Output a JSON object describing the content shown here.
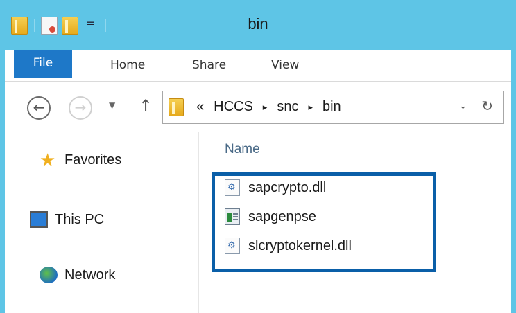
{
  "window": {
    "title": "bin"
  },
  "quick_access": {
    "icons": [
      "folder-icon",
      "properties-icon",
      "new-folder-icon",
      "customize-dropdown-icon"
    ],
    "dropdown_glyph": "="
  },
  "ribbon": {
    "tabs": [
      {
        "label": "File",
        "active": true
      },
      {
        "label": "Home"
      },
      {
        "label": "Share"
      },
      {
        "label": "View"
      }
    ]
  },
  "navigation": {
    "back_glyph": "←",
    "forward_glyph": "→",
    "recent_glyph": "▼",
    "up_glyph": "↑"
  },
  "address": {
    "overflow": "«",
    "crumbs": [
      "HCCS",
      "snc",
      "bin"
    ],
    "separator": "▸",
    "dropdown_glyph": "⌄",
    "refresh_glyph": "↻"
  },
  "nav_pane": {
    "items": [
      {
        "label": "Favorites",
        "icon": "star-icon"
      },
      {
        "label": "This PC",
        "icon": "computer-icon"
      },
      {
        "label": "Network",
        "icon": "network-icon"
      }
    ]
  },
  "file_list": {
    "column_header": "Name",
    "highlight_color": "#0a5fa8",
    "files": [
      {
        "name": "sapcrypto.dll",
        "icon": "dll-file-icon"
      },
      {
        "name": "sapgenpse",
        "icon": "executable-file-icon"
      },
      {
        "name": "slcryptokernel.dll",
        "icon": "dll-file-icon"
      }
    ]
  },
  "colors": {
    "titlebar": "#5ec5e6",
    "file_tab": "#1e78c8"
  }
}
